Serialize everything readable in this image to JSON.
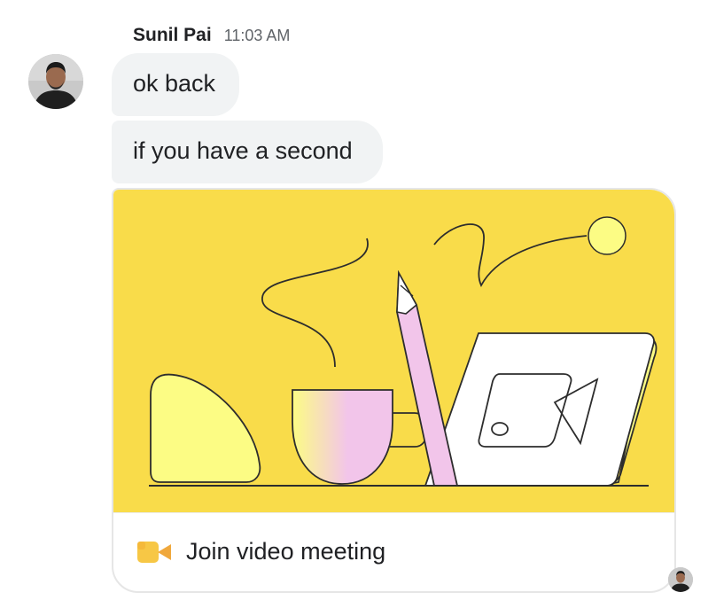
{
  "message_group": {
    "sender_name": "Sunil Pai",
    "timestamp": "11:03 AM",
    "messages": [
      {
        "text": "ok back"
      },
      {
        "text": "if you have a second"
      }
    ],
    "meeting_card": {
      "join_label": "Join video meeting",
      "illustration_icon": "video-meeting-illustration",
      "footer_icon": "google-meet-icon"
    }
  },
  "colors": {
    "bubble_bg": "#f1f3f4",
    "card_illustration_bg": "#f9dc4a",
    "text_primary": "#202124",
    "text_secondary": "#5f6368",
    "pastel_yellow": "#fcfc84",
    "pastel_pink": "#f2c5ea"
  }
}
